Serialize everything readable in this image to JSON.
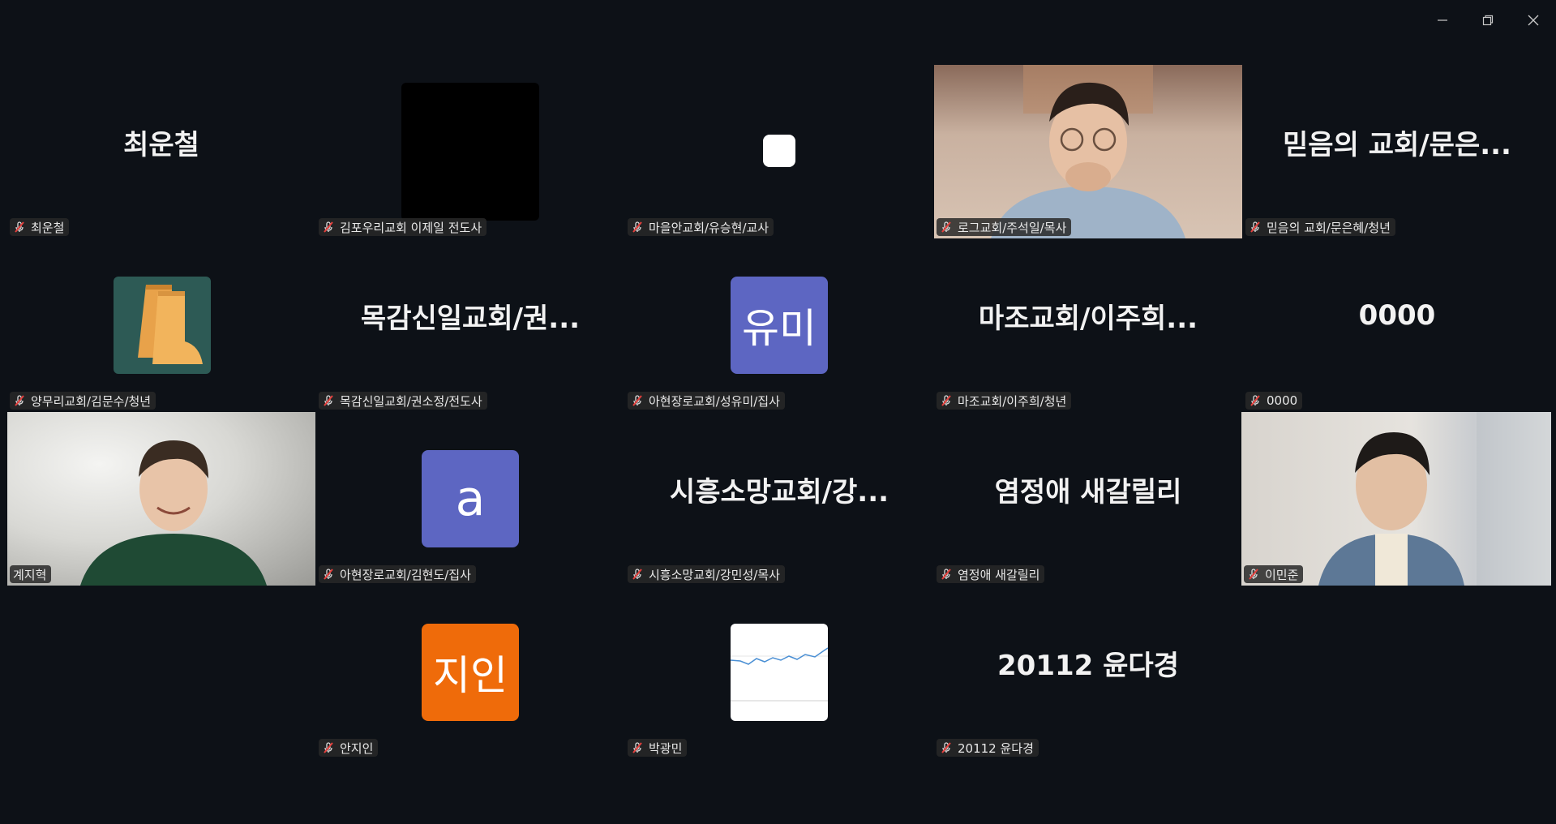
{
  "window": {
    "controls": [
      "minimize-icon",
      "restore-icon",
      "close-icon"
    ]
  },
  "colors": {
    "background": "#0d1117",
    "active_speaker": "#28d07d",
    "muted_mic": "#e5413e",
    "avatar_blue": "#5d66c2",
    "avatar_orange": "#ef6b0a"
  },
  "tiles": [
    {
      "big": "최운철",
      "label": "최운철"
    },
    {
      "big": "",
      "label": "김포우리교회 이제일 전도사"
    },
    {
      "big": "",
      "label": "마을안교회/유승현/교사"
    },
    {
      "big": "",
      "label": "로그교회/주석일/목사"
    },
    {
      "big": "믿음의 교회/문은...",
      "label": "믿음의 교회/문은혜/청년"
    },
    {
      "big": "",
      "label": "양무리교회/김문수/청년"
    },
    {
      "big": "목감신일교회/권...",
      "label": "목감신일교회/권소정/전도사"
    },
    {
      "big": "유미",
      "label": "아현장로교회/성유미/집사"
    },
    {
      "big": "마조교회/이주희...",
      "label": "마조교회/이주희/청년"
    },
    {
      "big": "0000",
      "label": "0000"
    },
    {
      "big": "",
      "label": "계지혁"
    },
    {
      "big": "a",
      "label": "아현장로교회/김현도/집사"
    },
    {
      "big": "시흥소망교회/강...",
      "label": "시흥소망교회/강민성/목사"
    },
    {
      "big": "염정애 새갈릴리",
      "label": "염정애 새갈릴리"
    },
    {
      "big": "",
      "label": "이민준"
    },
    {
      "big": "지인",
      "label": "안지인"
    },
    {
      "big": "",
      "label": "박광민"
    },
    {
      "big": "20112 윤다경",
      "label": "20112 윤다경"
    }
  ]
}
